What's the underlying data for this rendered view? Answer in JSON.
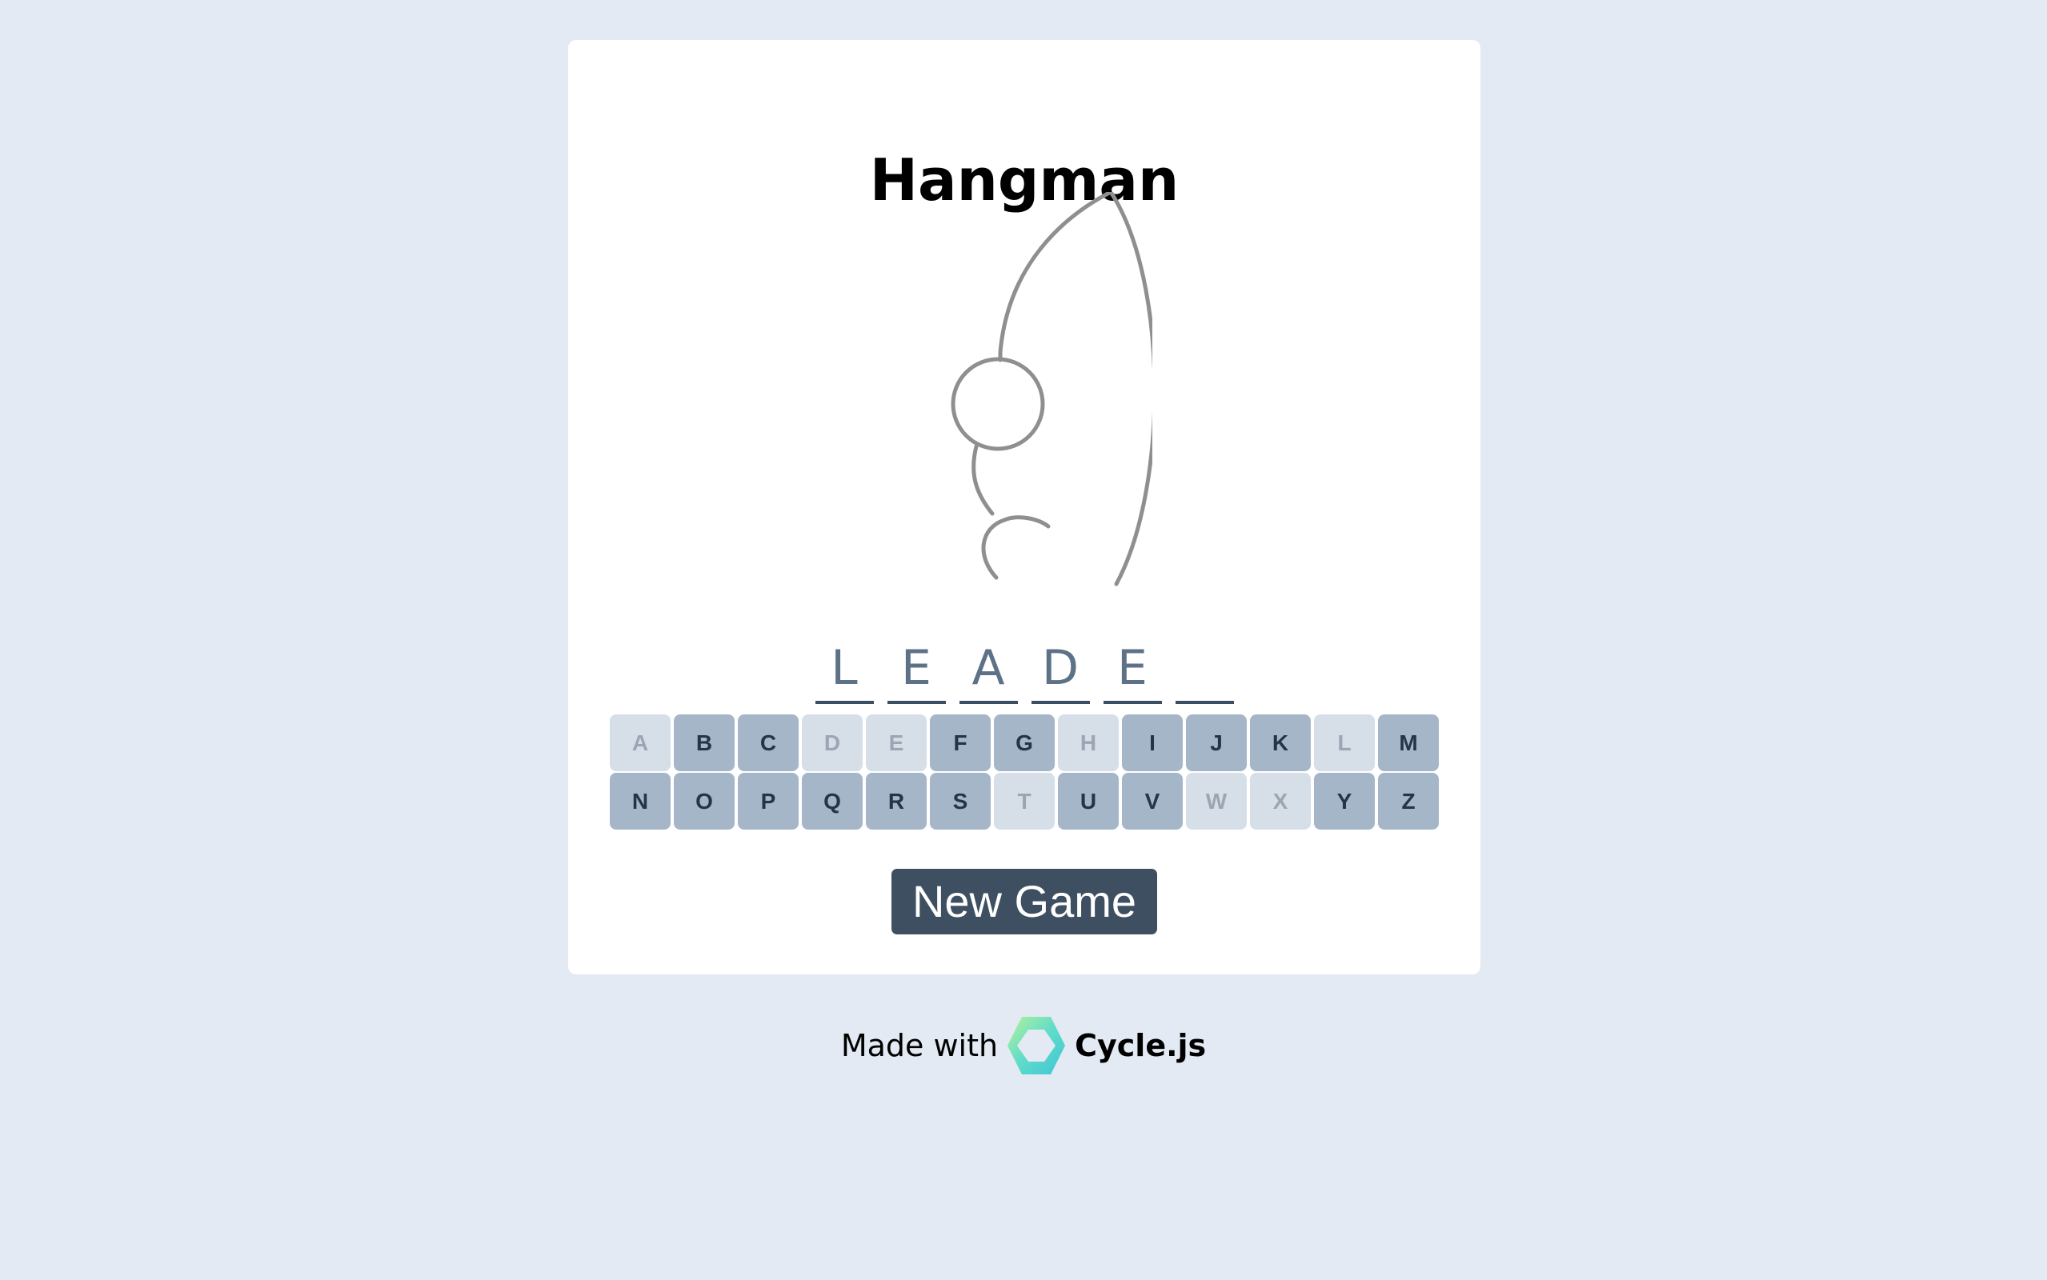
{
  "game": {
    "title": "Hangman",
    "word_slots": [
      "L",
      "E",
      "A",
      "D",
      "E",
      ""
    ],
    "keyboard": [
      {
        "letter": "A",
        "state": "used"
      },
      {
        "letter": "B",
        "state": "available"
      },
      {
        "letter": "C",
        "state": "available"
      },
      {
        "letter": "D",
        "state": "used"
      },
      {
        "letter": "E",
        "state": "used"
      },
      {
        "letter": "F",
        "state": "available"
      },
      {
        "letter": "G",
        "state": "available"
      },
      {
        "letter": "H",
        "state": "used"
      },
      {
        "letter": "I",
        "state": "available"
      },
      {
        "letter": "J",
        "state": "available"
      },
      {
        "letter": "K",
        "state": "available"
      },
      {
        "letter": "L",
        "state": "used"
      },
      {
        "letter": "M",
        "state": "available"
      },
      {
        "letter": "N",
        "state": "available"
      },
      {
        "letter": "O",
        "state": "available"
      },
      {
        "letter": "P",
        "state": "available"
      },
      {
        "letter": "Q",
        "state": "available"
      },
      {
        "letter": "R",
        "state": "available"
      },
      {
        "letter": "S",
        "state": "available"
      },
      {
        "letter": "T",
        "state": "used"
      },
      {
        "letter": "U",
        "state": "available"
      },
      {
        "letter": "V",
        "state": "available"
      },
      {
        "letter": "W",
        "state": "used"
      },
      {
        "letter": "X",
        "state": "used"
      },
      {
        "letter": "Y",
        "state": "available"
      },
      {
        "letter": "Z",
        "state": "available"
      }
    ],
    "new_game_label": "New Game",
    "hangman_parts_shown": [
      "gallows-curve",
      "head",
      "neck",
      "torso-curl"
    ]
  },
  "footer": {
    "made_with": "Made with",
    "brand": "Cycle.js",
    "logo_icon": "cyclejs-hexagon-logo-icon"
  },
  "colors": {
    "background": "#e3eaf3",
    "card": "#ffffff",
    "key_available": "#a5b6c8",
    "key_used": "#d6dee7",
    "button": "#3e4f61",
    "drawing_stroke": "#8f8f8f"
  }
}
